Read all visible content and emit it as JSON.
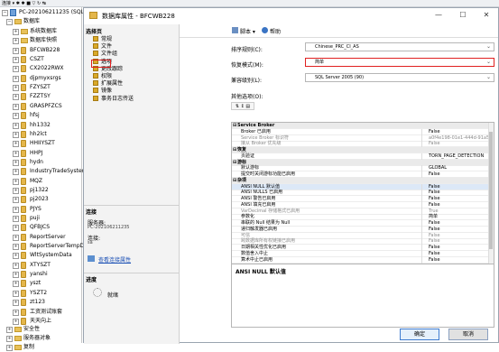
{
  "toolbar": {
    "text": "连接 ▾ ✱ ✱ ■ ▽ ↻ ↹"
  },
  "tree": {
    "server": "PC-202106211235 (SQL Serve",
    "databases": "数据库",
    "items": [
      "系统数据库",
      "数据库快照",
      "BFCWB228",
      "CSZT",
      "CX2022RWX",
      "djpmyxsrgs",
      "FZYSZT",
      "FZZTSY",
      "GRASPFZCS",
      "hfsj",
      "hh1332",
      "hh2lct",
      "HHIIYSZT",
      "HHPJ",
      "hydn",
      "IndustryTradeSystem",
      "MQZ",
      "pj1322",
      "pj2023",
      "PJYS",
      "puji",
      "QFBJCS",
      "ReportServer",
      "ReportServerTempDB",
      "WltSystemData",
      "XTYSZT",
      "yanshi",
      "yszt",
      "YSZT2",
      "zt123",
      "工资测试账套",
      "天天向上"
    ],
    "bottom": [
      "安全性",
      "服务器对象",
      "复制"
    ]
  },
  "dialog": {
    "title": "数据库属性 - BFCWB228",
    "minimize": "—",
    "maximize": "☐",
    "close": "✕",
    "select_page": "选择页",
    "pages": [
      "常规",
      "文件",
      "文件组",
      "选项",
      "更改跟踪",
      "权限",
      "扩展属性",
      "镜像",
      "事务日志传送"
    ],
    "connection": {
      "heading": "连接",
      "server_label": "服务器:",
      "server_value": "PC-202106211235",
      "conn_label": "连接:",
      "conn_value": "sa",
      "view_link": "查看连接属性"
    },
    "progress": {
      "heading": "进度",
      "status": "就绪"
    },
    "script_btn": "脚本 ▾",
    "help_btn": "帮助",
    "collation_label": "排序规则(C):",
    "collation_value": "Chinese_PRC_CI_AS",
    "recovery_label": "恢复模式(M):",
    "recovery_value": "简单",
    "compat_label": "兼容级别(L):",
    "compat_value": "SQL Server 2005 (90)",
    "other_label": "其他选项(O):",
    "grid_rows": [
      {
        "kind": "cat",
        "name": "Service Broker",
        "value": ""
      },
      {
        "kind": "norm",
        "name": "Broker 已启用",
        "value": "False"
      },
      {
        "kind": "grey",
        "name": "Service Broker 标识符",
        "value": "a0f4e198-01e1-444d-91a5-d51a645900fd"
      },
      {
        "kind": "grey",
        "name": "接从 Broker 优先级",
        "value": "False"
      },
      {
        "kind": "cat",
        "name": "恢复",
        "value": ""
      },
      {
        "kind": "norm",
        "name": "页验证",
        "value": "TORN_PAGE_DETECTION"
      },
      {
        "kind": "cat",
        "name": "游标",
        "value": ""
      },
      {
        "kind": "norm",
        "name": "默认游标",
        "value": "GLOBAL"
      },
      {
        "kind": "norm",
        "name": "提交时关闭游标功能已启用",
        "value": "False"
      },
      {
        "kind": "cat",
        "name": "杂项",
        "value": ""
      },
      {
        "kind": "sel",
        "name": "ANSI NULL 默认值",
        "value": "False"
      },
      {
        "kind": "norm",
        "name": "ANSI NULLS 已启用",
        "value": "False"
      },
      {
        "kind": "norm",
        "name": "ANSI 警告已启用",
        "value": "False"
      },
      {
        "kind": "norm",
        "name": "ANSI 填充已启用",
        "value": "False"
      },
      {
        "kind": "grey",
        "name": "VarDecimal 存储格式已启用",
        "value": "True"
      },
      {
        "kind": "norm",
        "name": "参数化",
        "value": "简单"
      },
      {
        "kind": "norm",
        "name": "串联的 Null 结果为 Null",
        "value": "False"
      },
      {
        "kind": "norm",
        "name": "递归触发器已启用",
        "value": "False"
      },
      {
        "kind": "grey",
        "name": "可信",
        "value": "False"
      },
      {
        "kind": "grey",
        "name": "跨数据库所有权链接已启用",
        "value": "False"
      },
      {
        "kind": "norm",
        "name": "日期相关性优化已启用",
        "value": "False"
      },
      {
        "kind": "norm",
        "name": "数值舍入中止",
        "value": "False"
      },
      {
        "kind": "norm",
        "name": "算术中止已启用",
        "value": "False"
      }
    ],
    "desc_title": "ANSI NULL 默认值",
    "ok": "确定",
    "cancel": "取消"
  }
}
